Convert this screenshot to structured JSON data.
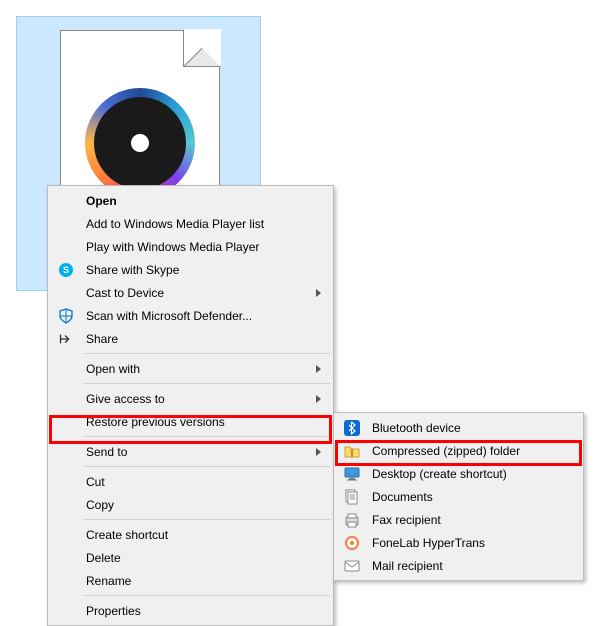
{
  "menu": {
    "open": "Open",
    "add_wmp": "Add to Windows Media Player list",
    "play_wmp": "Play with Windows Media Player",
    "share_skype": "Share with Skype",
    "cast": "Cast to Device",
    "scan_defender": "Scan with Microsoft Defender...",
    "share": "Share",
    "open_with": "Open with",
    "give_access": "Give access to",
    "restore_versions": "Restore previous versions",
    "send_to": "Send to",
    "cut": "Cut",
    "copy": "Copy",
    "create_shortcut": "Create shortcut",
    "delete": "Delete",
    "rename": "Rename",
    "properties": "Properties"
  },
  "submenu": {
    "bluetooth": "Bluetooth device",
    "compressed": "Compressed (zipped) folder",
    "desktop_shortcut": "Desktop (create shortcut)",
    "documents": "Documents",
    "fax": "Fax recipient",
    "fonelab": "FoneLab HyperTrans",
    "mail": "Mail recipient"
  }
}
